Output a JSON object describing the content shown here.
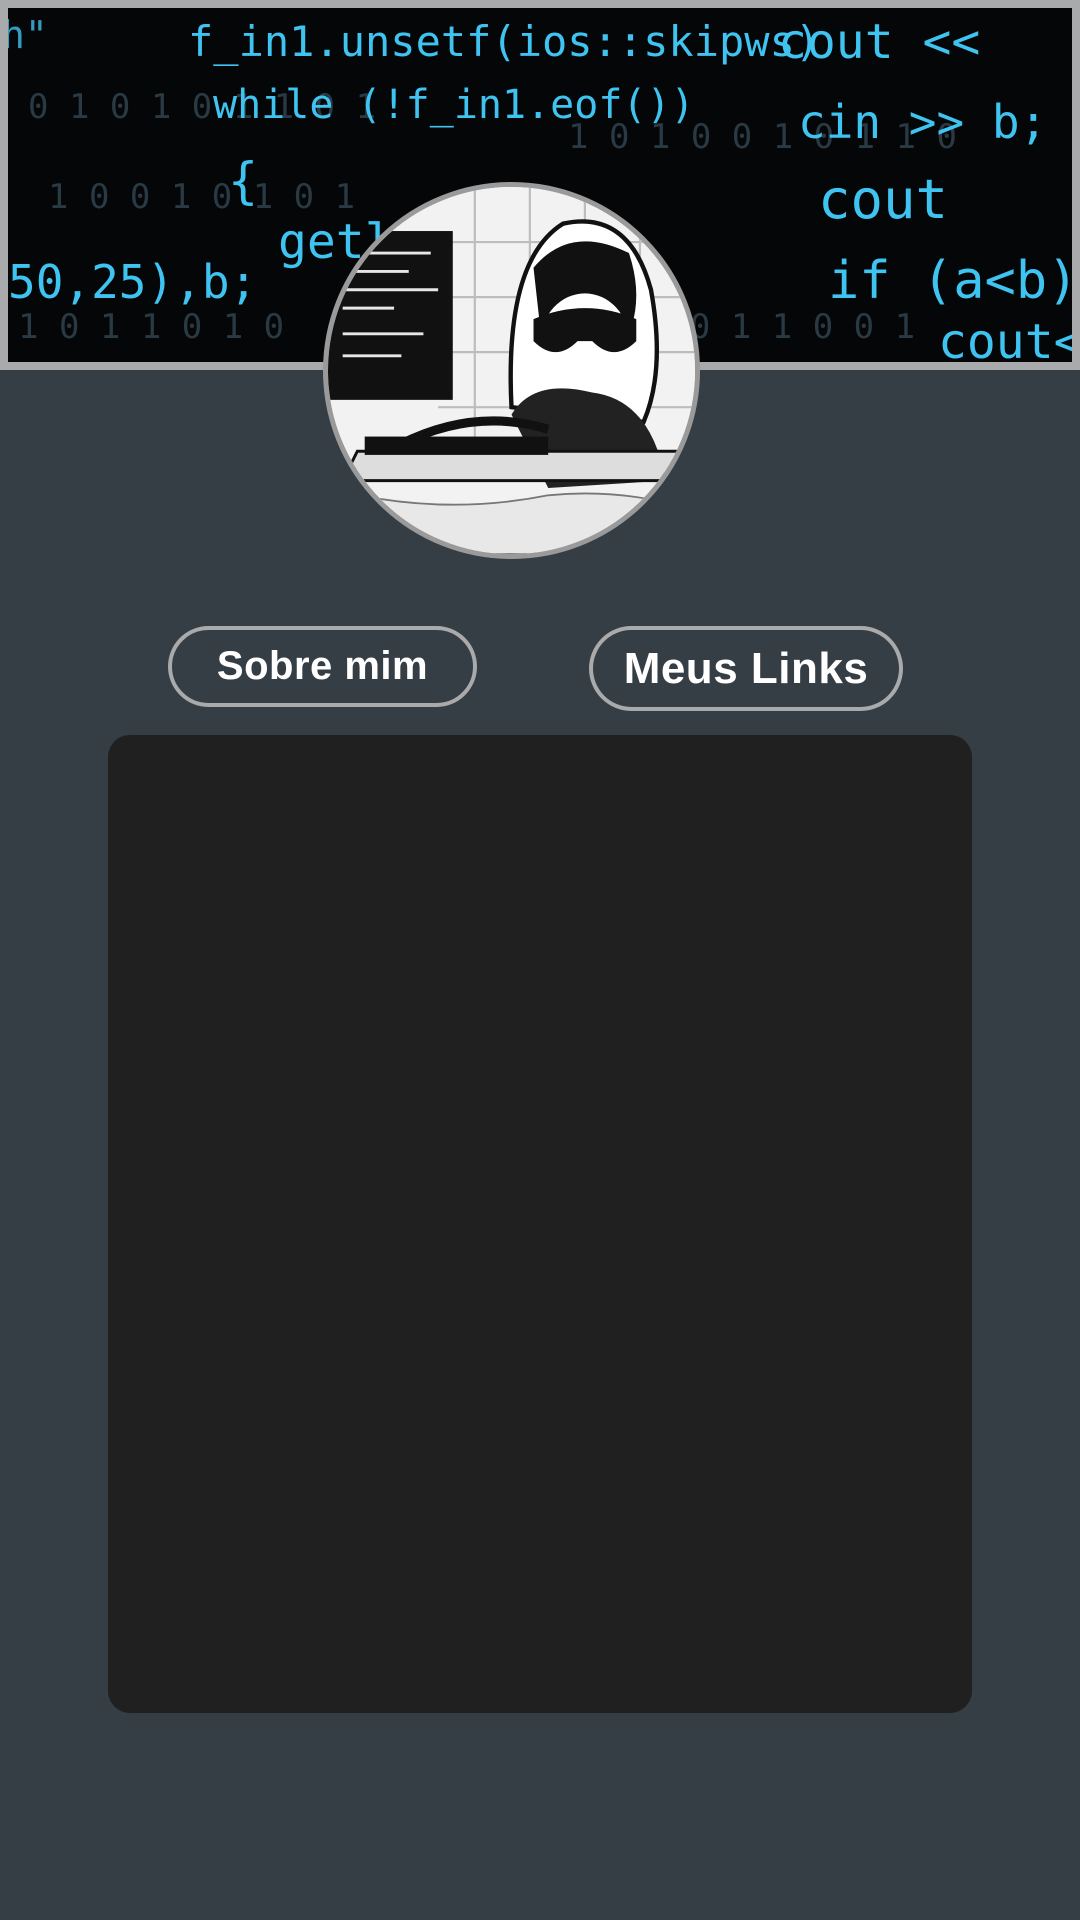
{
  "banner": {
    "image": "code-background-banner",
    "code_lines": [
      "h\"",
      "f_in1.unsetf(ios::skipws)",
      "cout <<",
      "while (!f_in1.eof())",
      "cin >> b;",
      "{",
      "cout",
      "50,25),b;",
      "getline",
      "if (a<b)",
      "cout<<"
    ],
    "accent_color": "#3fc3f0"
  },
  "avatar": {
    "image": "hacker-girl-avatar"
  },
  "nav": {
    "about_label": "Sobre mim",
    "links_label": "Meus Links"
  },
  "content_panel": {
    "items": []
  },
  "colors": {
    "background": "#363e45",
    "panel": "#202020",
    "border": "#a9aaab",
    "text": "#ffffff"
  }
}
